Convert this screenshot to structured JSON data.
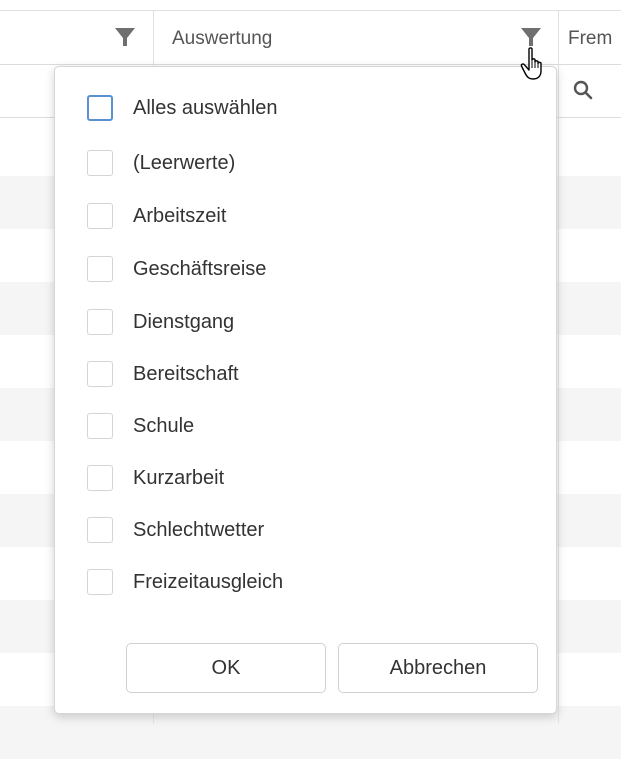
{
  "grid": {
    "columns": [
      {
        "header": "",
        "has_filter": true
      },
      {
        "header": "Auswertung",
        "has_filter": true
      },
      {
        "header": "Frem",
        "has_filter": false
      }
    ]
  },
  "filter_popup": {
    "items": [
      {
        "label": "Alles auswählen",
        "checked": false
      },
      {
        "label": "(Leerwerte)",
        "checked": false
      },
      {
        "label": "Arbeitszeit",
        "checked": false
      },
      {
        "label": "Geschäftsreise",
        "checked": false
      },
      {
        "label": "Dienstgang",
        "checked": false
      },
      {
        "label": "Bereitschaft",
        "checked": false
      },
      {
        "label": "Schule",
        "checked": false
      },
      {
        "label": "Kurzarbeit",
        "checked": false
      },
      {
        "label": "Schlechtwetter",
        "checked": false
      },
      {
        "label": "Freizeitausgleich",
        "checked": false
      }
    ],
    "ok_label": "OK",
    "cancel_label": "Abbrechen"
  },
  "colors": {
    "focus_border": "#5b8fd6",
    "filter_icon": "#6f6f6f",
    "row_stripe": "#f5f5f5"
  }
}
